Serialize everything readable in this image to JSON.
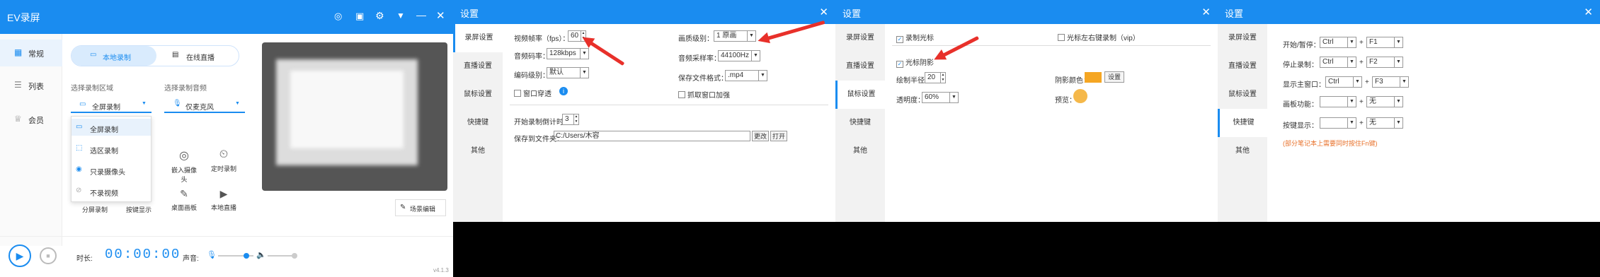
{
  "main": {
    "title": "EV录屏",
    "nav": [
      {
        "label": "常规",
        "icon": "grid-icon"
      },
      {
        "label": "列表",
        "icon": "list-icon"
      },
      {
        "label": "会员",
        "icon": "crown-icon"
      }
    ],
    "tabs": {
      "local": "本地录制",
      "live": "在线直播"
    },
    "area_label": "选择录制区域",
    "audio_label": "选择录制音频",
    "area_value": "全屏录制",
    "audio_value": "仅麦克风",
    "area_options": [
      "全屏录制",
      "选区录制",
      "只录摄像头",
      "不录视频"
    ],
    "tools": [
      "嵌入摄像头",
      "定时录制",
      "桌面画板",
      "本地直播"
    ],
    "bottom_tools": [
      "分屏录制",
      "按键显示"
    ],
    "scene_edit": "场景编辑",
    "duration_label": "时长:",
    "timer": [
      "00",
      "00",
      "00"
    ],
    "sound_label": "声音:",
    "version": "v4.1.3"
  },
  "settings_title": "设置",
  "sidebar": [
    "录屏设置",
    "直播设置",
    "鼠标设置",
    "快捷键",
    "其他"
  ],
  "p1": {
    "fps_label": "视频帧率（fps）：",
    "fps": "60",
    "quality_label": "画质级别：",
    "quality": "1 原画",
    "abitrate_label": "音频码率：",
    "abitrate": "128kbps",
    "asample_label": "音频采样率：",
    "asample": "44100Hz",
    "enc_label": "编码级别：",
    "enc": "默认",
    "format_label": "保存文件格式：",
    "format": ".mp4",
    "window_pass": "窗口穿透",
    "capture_boost": "抓取窗口加强",
    "countdown_label": "开始录制倒计时：",
    "countdown": "3",
    "save_label": "保存到文件夹：",
    "save_path": "C:/Users/木容",
    "change": "更改",
    "open": "打开"
  },
  "p2": {
    "record_cursor": "录制光标",
    "cursor_lr": "光标左右键录制（vip）",
    "cursor_shadow": "光标阴影",
    "radius_label": "绘制半径：",
    "radius": "20",
    "shadow_color_label": "阴影颜色：",
    "setting": "设置",
    "opacity_label": "透明度：",
    "opacity": "60%",
    "preview_label": "预览：",
    "shadow_color": "#f5a623"
  },
  "p3": {
    "rows": [
      {
        "label": "开始/暂停：",
        "mod": "Ctrl",
        "key": "F1"
      },
      {
        "label": "停止录制：",
        "mod": "Ctrl",
        "key": "F2"
      },
      {
        "label": "显示主窗口：",
        "mod": "Ctrl",
        "key": "F3"
      },
      {
        "label": "画板功能：",
        "mod": "",
        "key": "无"
      },
      {
        "label": "按键显示：",
        "mod": "",
        "key": "无"
      }
    ],
    "note": "(部分笔记本上需要同时按住Fn键)"
  },
  "colors": {
    "accent": "#1a8cf0",
    "arrow": "#e8302a",
    "note": "#e8712a"
  }
}
